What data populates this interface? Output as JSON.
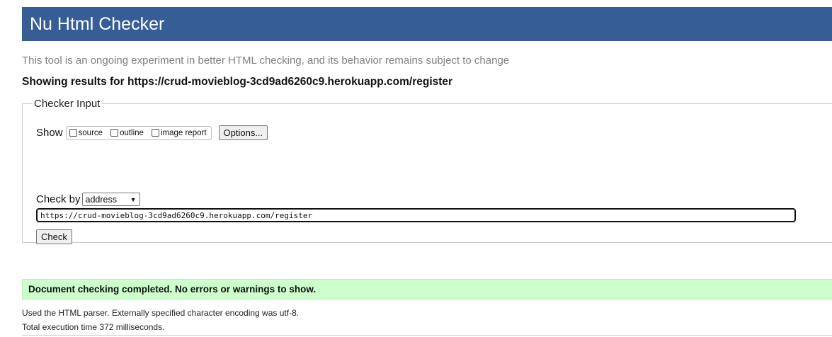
{
  "header": {
    "title": "Nu Html Checker",
    "bg_color": "#365d95"
  },
  "tagline": "This tool is an ongoing experiment in better HTML checking, and its behavior remains subject to change",
  "showing": "Showing results for https://crud-movieblog-3cd9ad6260c9.herokuapp.com/register",
  "checker_input": {
    "legend": "Checker Input",
    "show_label": "Show",
    "options": [
      {
        "label": "source",
        "checked": false
      },
      {
        "label": "outline",
        "checked": false
      },
      {
        "label": "image report",
        "checked": false
      }
    ],
    "options_button": "Options...",
    "check_by_label": "Check by",
    "check_by_selected": "address",
    "url_value": "https://crud-movieblog-3cd9ad6260c9.herokuapp.com/register",
    "check_button": "Check"
  },
  "result": {
    "message": "Document checking completed. No errors or warnings to show.",
    "bg_color": "#ccffcc"
  },
  "details": {
    "parser": "Used the HTML parser. Externally specified character encoding was utf-8.",
    "time": "Total execution time 372 milliseconds."
  }
}
